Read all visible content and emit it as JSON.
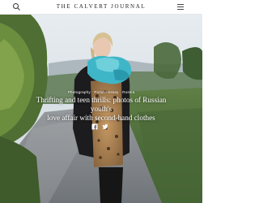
{
  "header": {
    "brand": "THE CALVERT JOURNAL",
    "search_icon": "search-icon",
    "menu_icon": "hamburger-menu-icon"
  },
  "article": {
    "tags": [
      "Photography",
      "Picture essay",
      "Russia"
    ],
    "headline_line1": "Thrifting and teen thrills: photos of Russian youth's",
    "headline_line2": "love affair with second-hand clothes"
  },
  "share": {
    "facebook_icon": "facebook-icon",
    "twitter_icon": "twitter-icon"
  },
  "colors": {
    "header_bg": "#ffffff",
    "overlay_text": "#ffffff",
    "scarf": "#3fb6c8",
    "sky": "#dfe6ec"
  }
}
